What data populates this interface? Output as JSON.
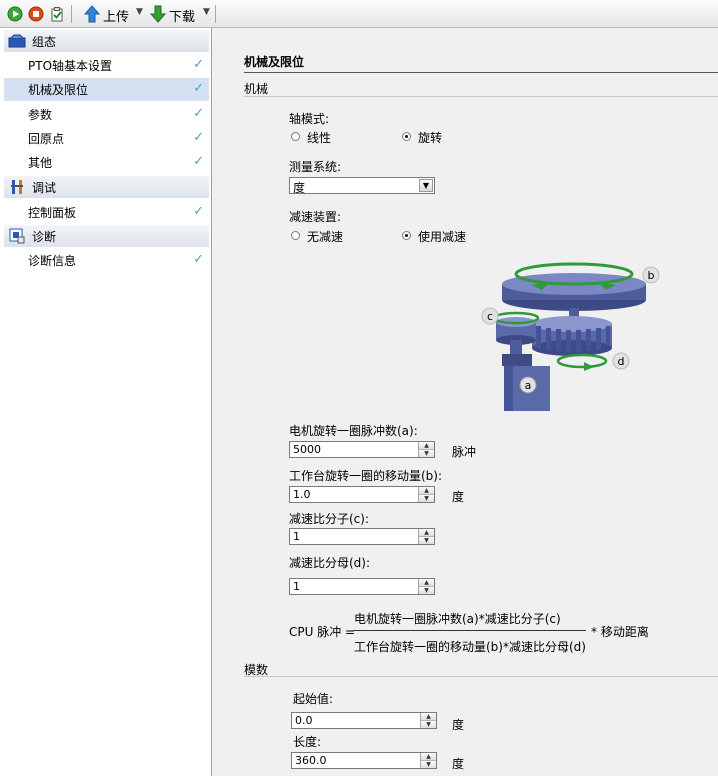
{
  "toolbar": {
    "upload_label": "上传",
    "download_label": "下载"
  },
  "nav": {
    "groups": [
      {
        "label": "组态",
        "icon": "config-icon"
      },
      {
        "label": "调试",
        "icon": "debug-tools-icon"
      },
      {
        "label": "诊断",
        "icon": "diagnostics-icon"
      }
    ],
    "items": [
      {
        "label": "PTO轴基本设置"
      },
      {
        "label": "机械及限位",
        "selected": true
      },
      {
        "label": "参数"
      },
      {
        "label": "回原点"
      },
      {
        "label": "其他"
      },
      {
        "label": "控制面板"
      },
      {
        "label": "诊断信息"
      }
    ],
    "check_glyph": "✓"
  },
  "page": {
    "title": "机械及限位",
    "section_mechanical": "机械",
    "axis_mode": {
      "label": "轴模式:",
      "options": [
        "线性",
        "旋转"
      ],
      "selected": "旋转"
    },
    "measure_system": {
      "label": "测量系统:",
      "value": "度"
    },
    "gearing": {
      "label": "减速装置:",
      "options": [
        "无减速",
        "使用减速"
      ],
      "selected": "使用减速"
    },
    "diagram": {
      "labels": [
        "a",
        "b",
        "c",
        "d"
      ]
    },
    "pulses_per_rev": {
      "label": "电机旋转一圈脉冲数(a):",
      "value": "5000",
      "unit": "脉冲"
    },
    "travel_per_rev": {
      "label": "工作台旋转一圈的移动量(b):",
      "value": "1.0",
      "unit": "度"
    },
    "ratio_numerator": {
      "label": "减速比分子(c):",
      "value": "1"
    },
    "ratio_denominator": {
      "label": "减速比分母(d):",
      "value": "1"
    },
    "formula": {
      "lhs": "CPU 脉冲 =",
      "numerator": "电机旋转一圈脉冲数(a)*减速比分子(c)",
      "denominator": "工作台旋转一圈的移动量(b)*减速比分母(d)",
      "rhs": "* 移动距离"
    },
    "section_modulo": "模数",
    "start_value": {
      "label": "起始值:",
      "value": "0.0",
      "unit": "度"
    },
    "length": {
      "label": "长度:",
      "value": "360.0",
      "unit": "度"
    }
  },
  "colors": {
    "selected_row": "#d5e1f2",
    "check": "#4aa3c8",
    "gear_blue": "#5a6aa8",
    "arrow_green": "#2e9a3a"
  }
}
